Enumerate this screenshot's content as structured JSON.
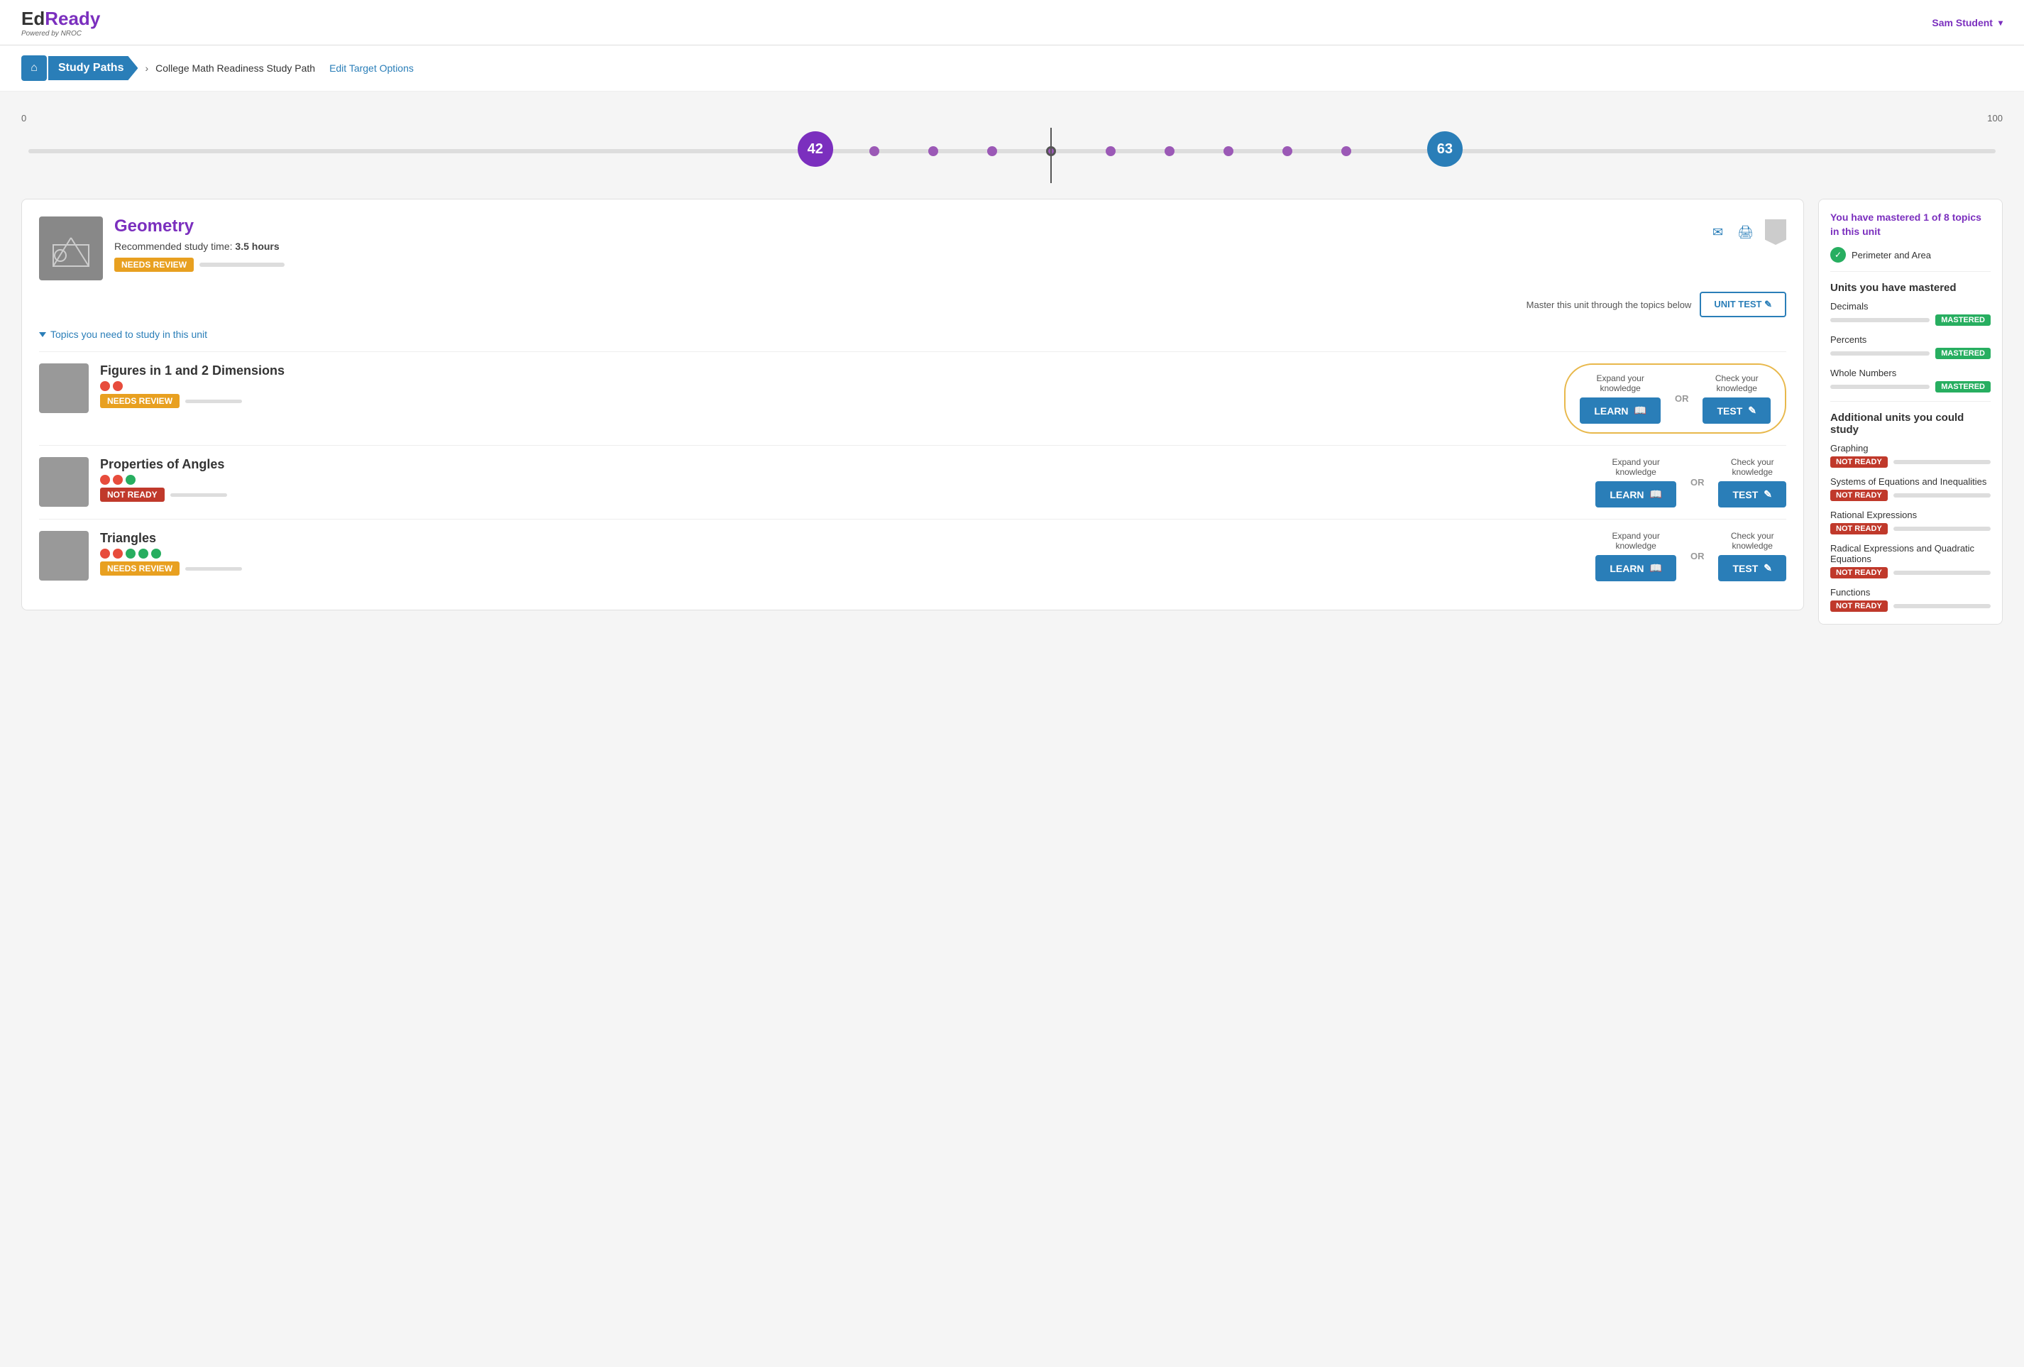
{
  "header": {
    "logo_ed": "Ed",
    "logo_ready": "Ready",
    "logo_powered": "Powered by NROC",
    "user_name": "Sam Student",
    "chevron": "▾"
  },
  "breadcrumb": {
    "home_icon": "⌂",
    "study_paths_label": "Study Paths",
    "current_path": "College Math Readiness Study Path",
    "edit_target": "Edit Target Options"
  },
  "progress": {
    "min": "0",
    "max": "100",
    "score_left": "42",
    "score_right": "63"
  },
  "unit": {
    "title": "Geometry",
    "study_time_label": "Recommended study time:",
    "study_time_value": "3.5 hours",
    "status": "NEEDS REVIEW",
    "master_label": "Master this unit through the topics below",
    "unit_test_btn": "UNIT TEST ✎",
    "topics_toggle": "Topics you need to study in this unit",
    "topics": [
      {
        "title": "Figures in 1 and 2 Dimensions",
        "dots": [
          "red",
          "red"
        ],
        "status": "NEEDS REVIEW",
        "expand_label": "Expand your knowledge",
        "or": "OR",
        "check_label": "Check your knowledge",
        "learn_btn": "LEARN",
        "test_btn": "TEST",
        "highlight": true
      },
      {
        "title": "Properties of Angles",
        "dots": [
          "red",
          "red",
          "green"
        ],
        "status": "NOT READY",
        "expand_label": "Expand your knowledge",
        "or": "OR",
        "check_label": "Check your knowledge",
        "learn_btn": "LEARN",
        "test_btn": "TEST",
        "highlight": false
      },
      {
        "title": "Triangles",
        "dots": [
          "red",
          "red",
          "green",
          "green",
          "green"
        ],
        "status": "NEEDS REVIEW",
        "expand_label": "Expand your knowledge",
        "or": "OR",
        "check_label": "Check your knowledge",
        "learn_btn": "LEARN",
        "test_btn": "TEST",
        "highlight": false
      }
    ]
  },
  "sidebar": {
    "mastered_summary": "You have mastered 1 of 8 topics in this unit",
    "mastered_topic": "Perimeter and Area",
    "units_mastered_title": "Units you have mastered",
    "mastered_units": [
      {
        "name": "Decimals",
        "status": "MASTERED"
      },
      {
        "name": "Percents",
        "status": "MASTERED"
      },
      {
        "name": "Whole Numbers",
        "status": "MASTERED"
      }
    ],
    "additional_title": "Additional units you could study",
    "additional_units": [
      {
        "name": "Graphing",
        "status": "NOT READY"
      },
      {
        "name": "Systems of Equations and Inequalities",
        "status": "NOT READY"
      },
      {
        "name": "Rational Expressions",
        "status": "NOT READY"
      },
      {
        "name": "Radical Expressions and Quadratic Equations",
        "status": "NOT READY"
      },
      {
        "name": "Functions",
        "status": "NOT READY"
      }
    ]
  },
  "icons": {
    "email": "✉",
    "print": "🖨",
    "learn_icon": "📖",
    "test_icon": "✎"
  }
}
